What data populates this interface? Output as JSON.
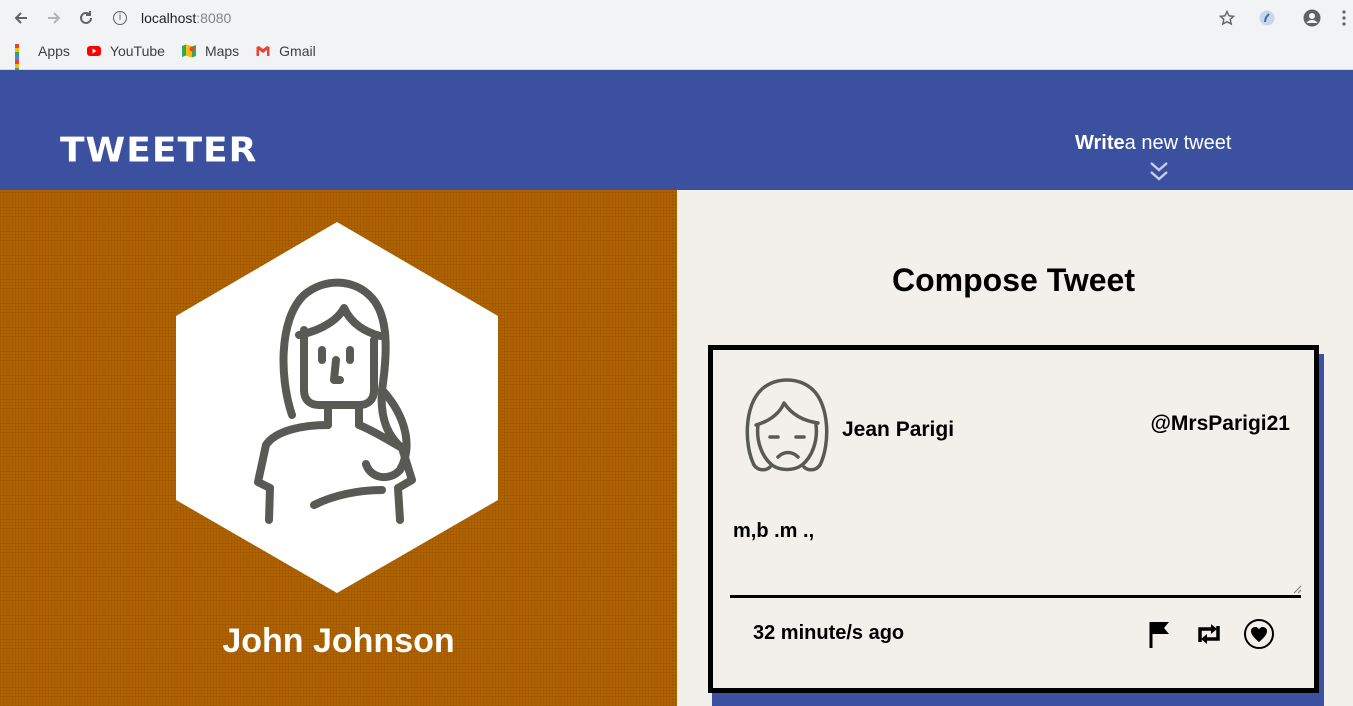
{
  "browser": {
    "url_host": "localhost",
    "url_port": ":8080",
    "bookmarks": [
      {
        "label": "Apps",
        "icon": "apps-grid-icon"
      },
      {
        "label": "YouTube",
        "icon": "youtube-icon"
      },
      {
        "label": "Maps",
        "icon": "maps-icon"
      },
      {
        "label": "Gmail",
        "icon": "gmail-icon"
      }
    ]
  },
  "header": {
    "logo": "Tweeter",
    "write_bold": "Write",
    "write_rest": "a new tweet"
  },
  "profile": {
    "name": "John Johnson"
  },
  "compose": {
    "title": "Compose Tweet",
    "tweet": {
      "name": "Jean Parigi",
      "handle": "@MrsParigi21",
      "text": "m,b .m .,",
      "time": "32 minute/s ago"
    }
  },
  "colors": {
    "header_bg": "#3b51a0",
    "left_bg": "#b06300",
    "page_bg": "#f3f0ec"
  }
}
